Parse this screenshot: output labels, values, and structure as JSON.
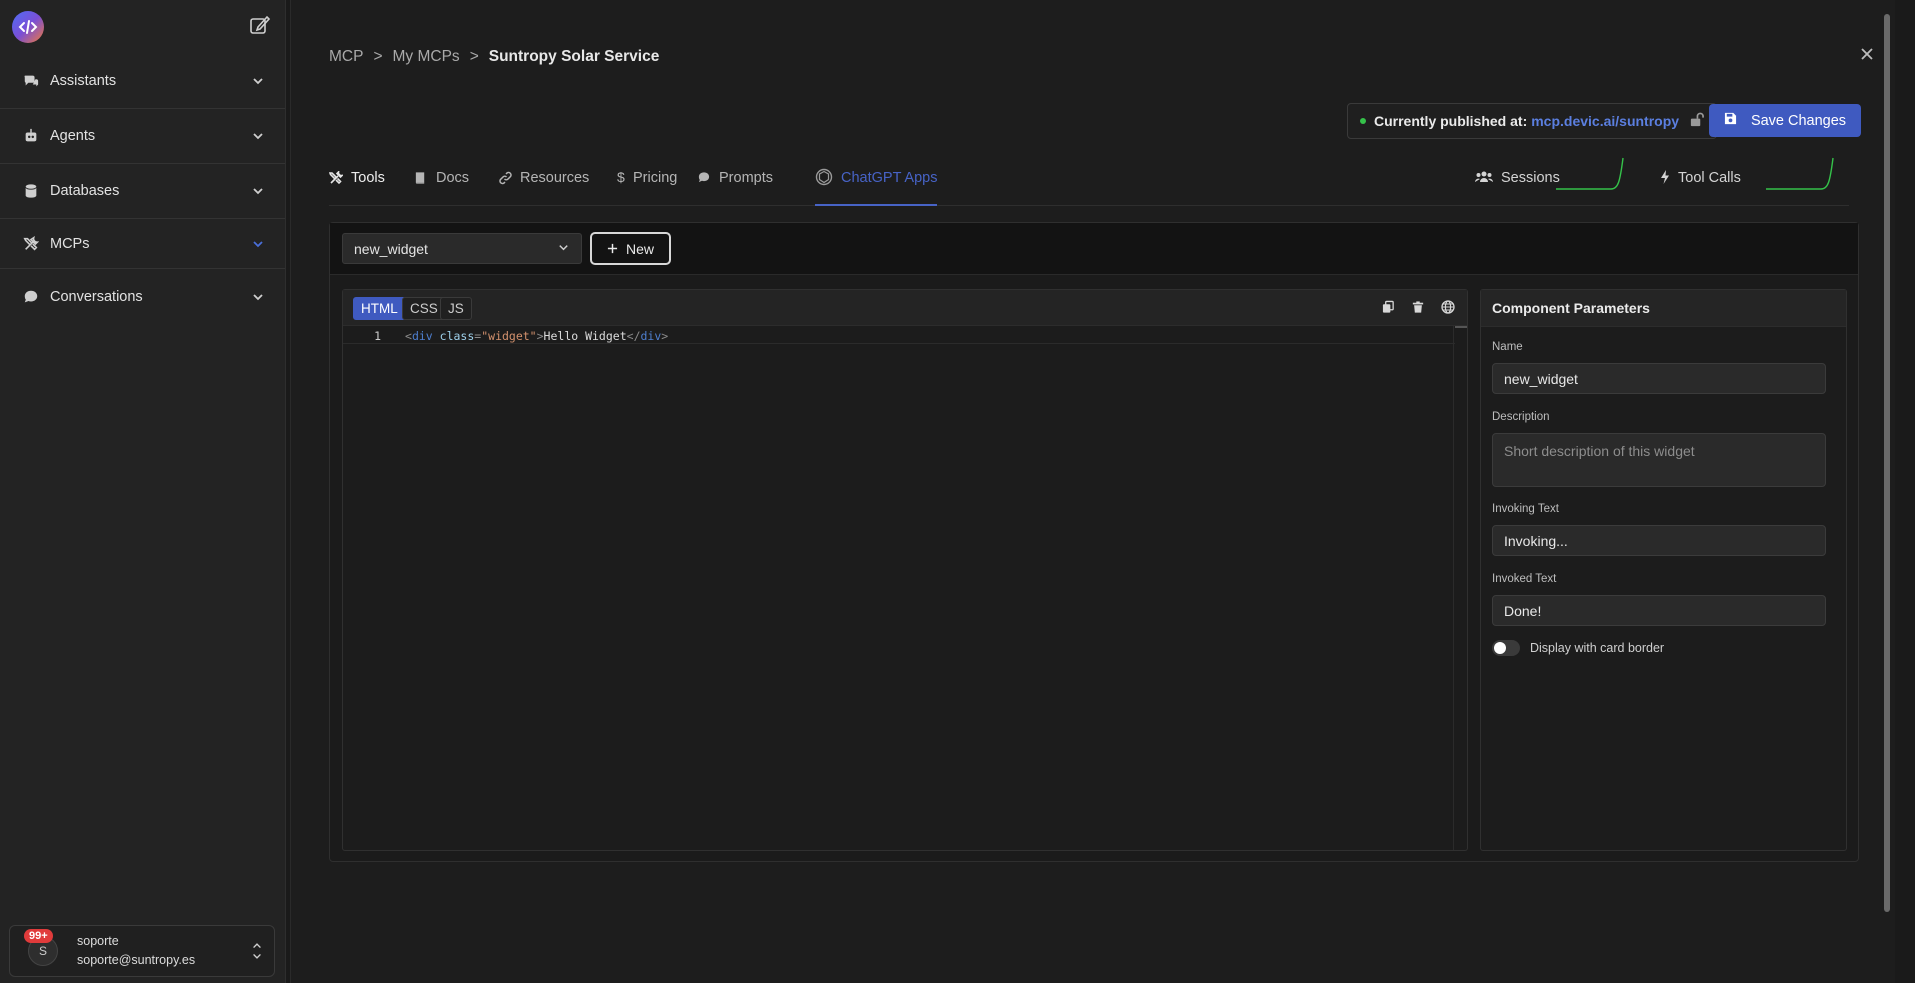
{
  "sidebar": {
    "items": [
      {
        "label": "Assistants",
        "icon": "chat-bubbles-icon"
      },
      {
        "label": "Agents",
        "icon": "robot-icon"
      },
      {
        "label": "Databases",
        "icon": "database-icon"
      },
      {
        "label": "MCPs",
        "icon": "tools-icon"
      },
      {
        "label": "Conversations",
        "icon": "chat-icon"
      }
    ],
    "user": {
      "badge": "99+",
      "initial": "S",
      "name": "soporte",
      "email": "soporte@suntropy.es"
    }
  },
  "breadcrumb": {
    "items": [
      "MCP",
      "My MCPs"
    ],
    "current": "Suntropy Solar Service",
    "separator": ">"
  },
  "publish": {
    "label": "Currently published at:",
    "url": "mcp.devic.ai/suntropy",
    "status_color": "#35c24a"
  },
  "actions": {
    "save_label": "Save Changes"
  },
  "tabs": [
    {
      "label": "Tools",
      "icon": "tools-icon"
    },
    {
      "label": "Docs",
      "icon": "book-icon"
    },
    {
      "label": "Resources",
      "icon": "link-icon"
    },
    {
      "label": "Pricing",
      "icon": "dollar-icon"
    },
    {
      "label": "Prompts",
      "icon": "chat-icon"
    },
    {
      "label": "ChatGPT Apps",
      "icon": "openai-icon"
    }
  ],
  "stats": [
    {
      "label": "Sessions",
      "icon": "users-icon"
    },
    {
      "label": "Tool Calls",
      "icon": "bolt-icon"
    }
  ],
  "widget_select": {
    "value": "new_widget"
  },
  "new_button": {
    "label": "New"
  },
  "editor": {
    "langs": [
      "HTML",
      "CSS",
      "JS"
    ],
    "active_lang": "HTML",
    "line_number": "1",
    "code": "<div class=\"widget\">Hello Widget</div>"
  },
  "params": {
    "title": "Component Parameters",
    "name_label": "Name",
    "name_value": "new_widget",
    "desc_label": "Description",
    "desc_placeholder": "Short description of this widget",
    "invoking_label": "Invoking Text",
    "invoking_value": "Invoking...",
    "invoked_label": "Invoked Text",
    "invoked_value": "Done!",
    "toggle_label": "Display with card border"
  },
  "colors": {
    "accent": "#3f5ac0",
    "tab_active": "#4763c6",
    "sparkline": "#35c24a"
  }
}
